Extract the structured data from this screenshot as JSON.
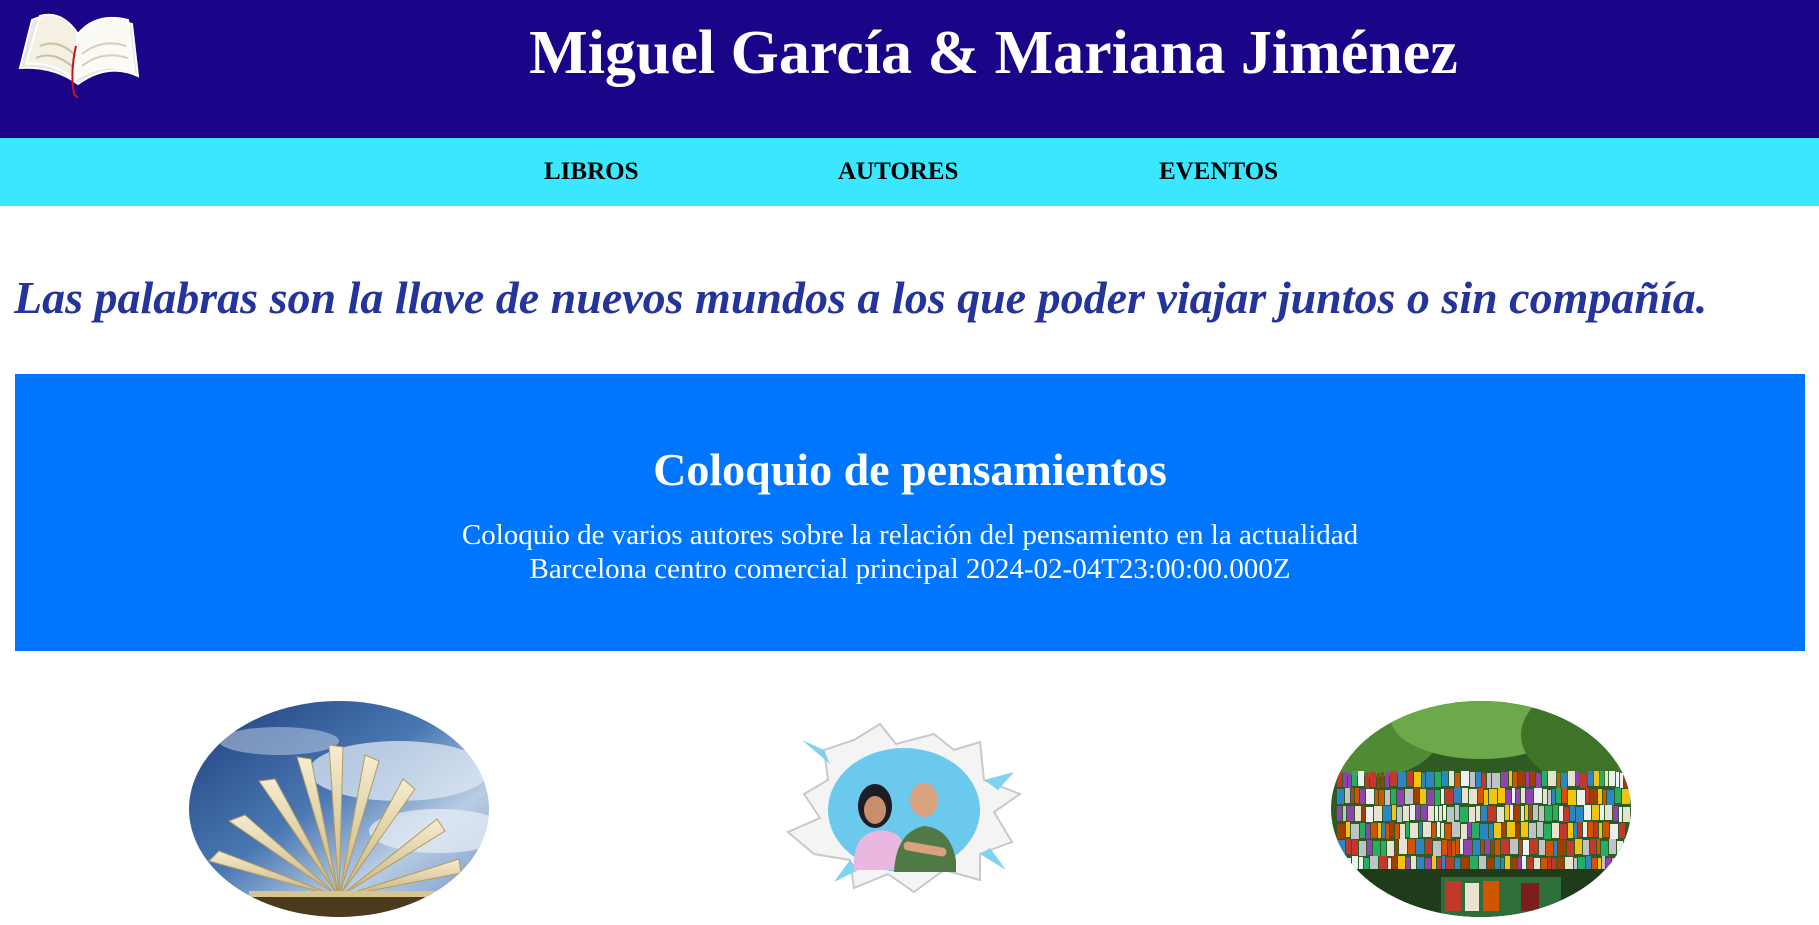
{
  "header": {
    "logo_icon": "open-book-icon",
    "title": "Miguel García & Mariana Jiménez",
    "background": "#1c0488"
  },
  "nav": {
    "background": "#3ae7ff",
    "items": [
      {
        "label": "LIBROS"
      },
      {
        "label": "AUTORES"
      },
      {
        "label": "EVENTOS"
      }
    ]
  },
  "tagline": "Las palabras son la llave de nuevos mundos a los que poder viajar juntos o sin compañía.",
  "event": {
    "background": "#0076ff",
    "title": "Coloquio de pensamientos",
    "description": "Coloquio de varios autores sobre la relación del pensamiento en la actualidad",
    "location_date": "Barcelona centro comercial principal 2024-02-04T23:00:00.000Z"
  },
  "images": [
    {
      "subject": "open book against blue sky"
    },
    {
      "subject": "two authors bursting through torn paper"
    },
    {
      "subject": "outdoor stall of stacked second-hand books"
    }
  ]
}
